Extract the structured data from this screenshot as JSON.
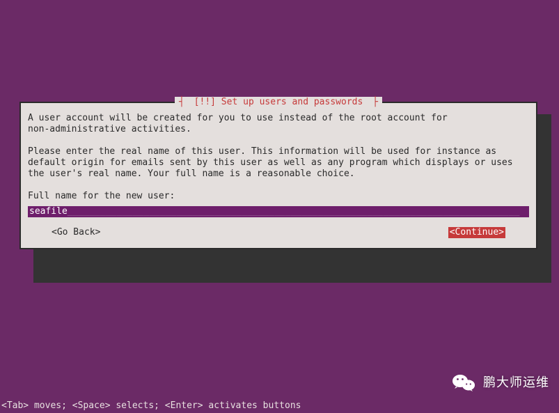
{
  "dialog": {
    "title": "[!!] Set up users and passwords",
    "para1": "A user account will be created for you to use instead of the root account for\nnon-administrative activities.",
    "para2": "Please enter the real name of this user. This information will be used for instance as\ndefault origin for emails sent by this user as well as any program which displays or uses\nthe user's real name. Your full name is a reasonable choice.",
    "prompt": "Full name for the new user:",
    "input_value": "seafile",
    "go_back": "<Go Back>",
    "continue": "<Continue>"
  },
  "hint": "<Tab> moves; <Space> selects; <Enter> activates buttons",
  "watermark": {
    "text": "鹏大师运维"
  },
  "colors": {
    "bg": "#6b2a66",
    "panel": "#e4dfdd",
    "accent": "#c63a3a",
    "input_bg": "#6e1e6b"
  }
}
